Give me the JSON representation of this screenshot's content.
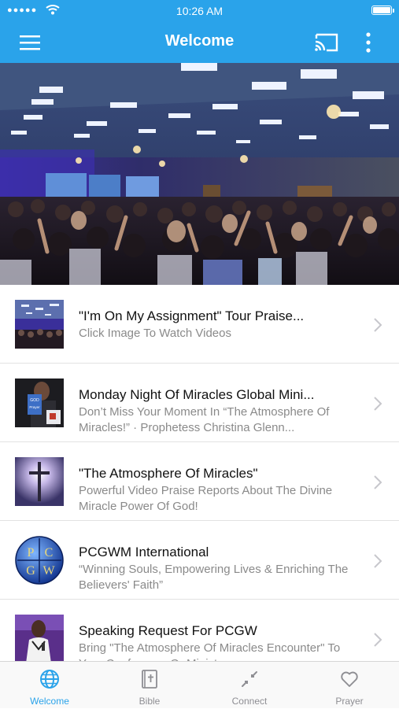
{
  "status": {
    "time": "10:26 AM",
    "signal": "●●●●●"
  },
  "nav": {
    "title": "Welcome"
  },
  "icons": {
    "menu": "hamburger-menu-icon",
    "cast": "cast-icon",
    "more": "more-vertical-icon",
    "chevron": "chevron-right-icon"
  },
  "colors": {
    "accent": "#2aa3ea",
    "inactive": "#8e8e93",
    "subtitle": "#8a8a8a"
  },
  "carousel": {
    "page_count": 3,
    "active_page": 1
  },
  "items": [
    {
      "title": "\"I'm On My Assignment\" Tour Praise...",
      "subtitle": "Click Image To Watch Videos"
    },
    {
      "title": "Monday Night Of Miracles Global Mini...",
      "subtitle": "Don’t Miss Your Moment In “The Atmosphere Of Miracles!” · Prophetess Christina Glenn..."
    },
    {
      "title": "\"The Atmosphere Of Miracles\"",
      "subtitle": "Powerful Video Praise Reports About The Divine Miracle Power Of God!"
    },
    {
      "title": "PCGWM International",
      "subtitle": "“Winning Souls, Empowering Lives & Enriching The Believers' Faith”"
    },
    {
      "title": "Speaking Request For PCGW",
      "subtitle": "Bring \"The Atmosphere Of Miracles Encounter\" To Your Conference Or Ministry"
    }
  ],
  "logo_letters": [
    "P",
    "C",
    "G",
    "W"
  ],
  "thumb_text": {
    "god": "GOD",
    "prayer": "Prayer"
  },
  "tabs": [
    {
      "label": "Welcome",
      "icon": "globe-icon",
      "active": true
    },
    {
      "label": "Bible",
      "icon": "bible-icon",
      "active": false
    },
    {
      "label": "Connect",
      "icon": "connect-icon",
      "active": false
    },
    {
      "label": "Prayer",
      "icon": "heart-icon",
      "active": false
    }
  ]
}
